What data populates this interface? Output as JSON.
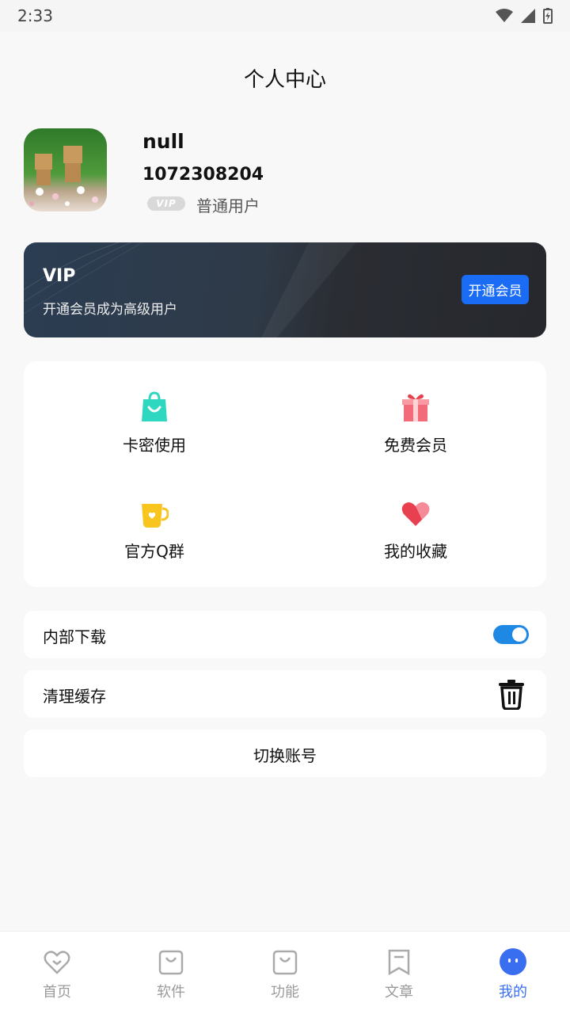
{
  "status_bar": {
    "time": "2:33"
  },
  "header": {
    "title": "个人中心"
  },
  "profile": {
    "name": "null",
    "id": "1072308204",
    "vip_badge": "VIP",
    "level": "普通用户"
  },
  "vip_card": {
    "title": "VIP",
    "subtitle": "开通会员成为高级用户",
    "button_label": "开通会员"
  },
  "grid": {
    "items": [
      {
        "label": "卡密使用",
        "icon": "shopping-bag-icon",
        "color": "#2ed8c0"
      },
      {
        "label": "免费会员",
        "icon": "gift-icon",
        "color": "#f06a7a"
      },
      {
        "label": "官方Q群",
        "icon": "cup-icon",
        "color": "#f7c51e"
      },
      {
        "label": "我的收藏",
        "icon": "heart-icon",
        "color": "#e8404e"
      }
    ]
  },
  "settings": {
    "internal_download": {
      "label": "内部下载",
      "enabled": true
    },
    "clear_cache": {
      "label": "清理缓存",
      "icon": "trash-icon"
    },
    "switch_account": {
      "label": "切换账号"
    }
  },
  "tab_bar": {
    "active_color": "#3a6ef0",
    "items": [
      {
        "label": "首页",
        "icon": "heart-outline-icon"
      },
      {
        "label": "软件",
        "icon": "bag-outline-icon"
      },
      {
        "label": "功能",
        "icon": "bag-outline-icon"
      },
      {
        "label": "文章",
        "icon": "bookmark-outline-icon"
      },
      {
        "label": "我的",
        "icon": "face-icon",
        "active": true
      }
    ]
  }
}
